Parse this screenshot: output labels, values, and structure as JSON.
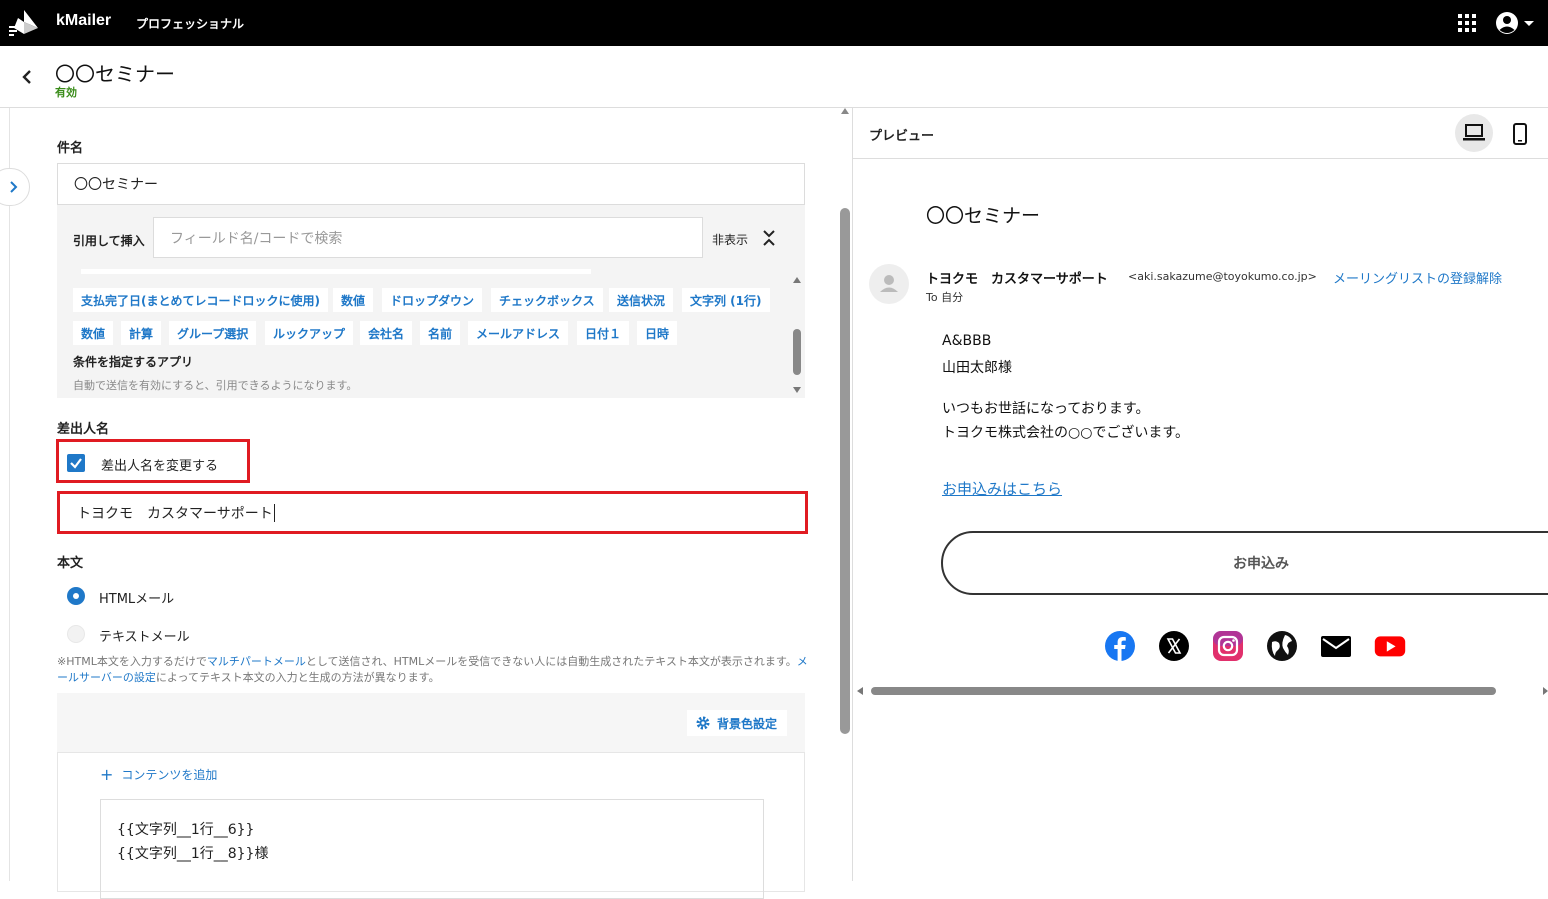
{
  "app": {
    "name": "kMailer",
    "edition": "プロフェッショナル"
  },
  "header": {
    "title": "〇〇セミナー",
    "status": "有効"
  },
  "form": {
    "subject_label": "件名",
    "subject_value": "〇〇セミナー",
    "insert": {
      "label": "引用して挿入",
      "search_placeholder": "フィールド名/コードで検索",
      "hide_label": "非表示",
      "chips_row1": [
        "支払完了日(まとめてレコードロックに使用)",
        "数値",
        "ドロップダウン",
        "チェックボックス",
        "送信状況",
        "文字列 (1行)"
      ],
      "chips_row2": [
        "数値",
        "計算",
        "グループ選択",
        "ルックアップ",
        "会社名",
        "名前",
        "メールアドレス",
        "日付１",
        "日時"
      ],
      "conditional_app_label": "条件を指定するアプリ",
      "conditional_app_hint": "自動で送信を有効にすると、引用できるようになります。"
    },
    "sender_label": "差出人名",
    "change_sender_label": "差出人名を変更する",
    "change_sender_checked": true,
    "sender_value": "トヨクモ　カスタマーサポート",
    "body_label": "本文",
    "body_options": [
      "HTMLメール",
      "テキストメール"
    ],
    "body_selected": "HTMLメール",
    "note": {
      "part1": "※HTML本文を入力するだけで",
      "link1": "マルチパートメール",
      "part2": "として送信され、HTMLメールを受信できない人には自動生成されたテキスト本文が表示されます。",
      "link2": "メールサーバーの設定",
      "part3": "によってテキスト本文の入力と生成の方法が異なります。"
    },
    "bg_color_button": "背景色設定",
    "add_content": "コンテンツを追加",
    "editor_lines": [
      "{{文字列__1行__6}}",
      "{{文字列__1行__8}}様"
    ]
  },
  "preview": {
    "label": "プレビュー",
    "subject": "〇〇セミナー",
    "sender_name": "トヨクモ　カスタマーサポート",
    "sender_email": "<aki.sakazume@toyokumo.co.jp>",
    "unsubscribe": "メーリングリストの登録解除",
    "to": "To 自分",
    "lines": [
      "A&BBB",
      "山田太郎様",
      "いつもお世話になっております。",
      "トヨクモ株式会社の○○でございます。"
    ],
    "apply_link": "お申込みはこちら",
    "apply_button": "お申込み",
    "social_icons": [
      "facebook-icon",
      "x-icon",
      "instagram-icon",
      "web-icon",
      "mail-icon",
      "youtube-icon"
    ]
  },
  "colors": {
    "accent": "#1f78c8",
    "highlight": "#e01b22",
    "status": "#3a8c1a"
  }
}
